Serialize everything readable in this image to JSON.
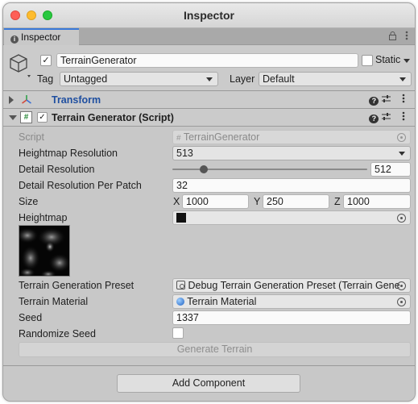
{
  "window": {
    "title": "Inspector"
  },
  "tab": {
    "label": "Inspector"
  },
  "header": {
    "object_name": "TerrainGenerator",
    "active": true,
    "static_label": "Static",
    "tag_label": "Tag",
    "tag_value": "Untagged",
    "layer_label": "Layer",
    "layer_value": "Default"
  },
  "components": {
    "transform": {
      "title": "Transform",
      "expanded": false
    },
    "terrain_generator": {
      "title": "Terrain Generator (Script)",
      "expanded": true
    }
  },
  "props": {
    "script_label": "Script",
    "script_value": "TerrainGenerator",
    "heightmap_resolution_label": "Heightmap Resolution",
    "heightmap_resolution_value": "513",
    "detail_resolution_label": "Detail Resolution",
    "detail_resolution_value": "512",
    "detail_resolution_slider_fraction": 0.16,
    "detail_per_patch_label": "Detail Resolution Per Patch",
    "detail_per_patch_value": "32",
    "size_label": "Size",
    "size_x_label": "X",
    "size_x": "1000",
    "size_y_label": "Y",
    "size_y": "250",
    "size_z_label": "Z",
    "size_z": "1000",
    "heightmap_label": "Heightmap",
    "preset_label": "Terrain Generation Preset",
    "preset_value": "Debug Terrain Generation Preset (Terrain Gene",
    "material_label": "Terrain Material",
    "material_value": "Terrain Material",
    "seed_label": "Seed",
    "seed_value": "1337",
    "randomize_label": "Randomize Seed",
    "randomize_checked": false,
    "generate_button": "Generate Terrain"
  },
  "footer": {
    "add_component": "Add Component"
  },
  "colors": {
    "transform_title": "#1f4fa0",
    "tab_accent": "#3a79d8"
  }
}
